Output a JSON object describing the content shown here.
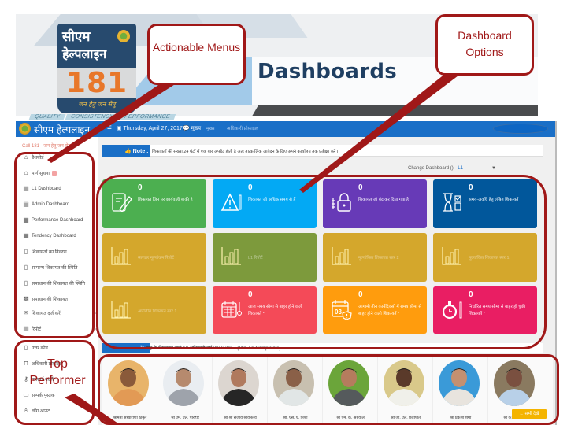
{
  "slide": {
    "title": "Dashboards",
    "tagline_steps": [
      "QUALITY",
      "CONSISTENCY",
      "PERFORMANCE"
    ]
  },
  "logo": {
    "line1": "सीएम",
    "line2": "हेल्पलाइन",
    "number": "181",
    "tagline": "जन हेतु जन सेतु"
  },
  "annotations": {
    "actionable_menus": "Actionable Menus",
    "dashboard_options": "Dashboard Options",
    "top_performer": "Top Performer",
    "color": "#a01818"
  },
  "appbar": {
    "brand": "सीएम हेल्पलाइन",
    "menu_icon": "≡",
    "date": "Thursday, April 27, 2017",
    "messages_label": "मुख्य",
    "link1": "मुख्य",
    "link2": "अधिकारी प्रोफ़ाइल",
    "color": "#1a6fc7"
  },
  "sidebar": {
    "phone": "Call 181 - जन हेतु जन सेतु",
    "items": [
      {
        "label": "डैशबोर्ड",
        "icon": "home-icon"
      },
      {
        "label": "मार्ग सूचना",
        "icon": "home-icon",
        "badge": true
      },
      {
        "label": "L1 Dashboard",
        "icon": "clipboard-icon"
      },
      {
        "label": "Admin Dashboard",
        "icon": "clipboard-icon"
      },
      {
        "label": "Performance Dashboard",
        "icon": "chart-icon"
      },
      {
        "label": "Tendency Dashboard",
        "icon": "chart-icon"
      },
      {
        "label": "शिकायतों का विवरण",
        "icon": "document-icon"
      },
      {
        "label": "सामान्य शिकायत की स्थिति",
        "icon": "document-icon"
      },
      {
        "label": "समाधान की शिकायत की स्थिति",
        "icon": "document-icon"
      },
      {
        "label": "समाधान की शिकायत",
        "icon": "grid-icon"
      },
      {
        "label": "शिकायत दर्ज करें",
        "icon": "mail-icon",
        "chevron": true
      },
      {
        "label": "रिपोर्ट",
        "icon": "calendar-icon",
        "chevron": true
      },
      {
        "label": "उत्तर कोड",
        "icon": "file-icon"
      },
      {
        "label": "अधिकारी प्रोफ़ाइल",
        "icon": "lock-icon"
      },
      {
        "label": "पासवर्ड बदलें",
        "icon": "key-icon"
      },
      {
        "label": "सम्पर्क पुस्तक",
        "icon": "book-icon"
      },
      {
        "label": "लॉग आउट",
        "icon": "user-icon"
      }
    ]
  },
  "note": {
    "tag": "Note :",
    "text": "शिकायतों की संख्या 24 घंटों में एक बार अपडेट होती है अतः तात्कालिक आवेदन के लिए अपने कार्यालय तक प्रतीक्षा करें |"
  },
  "change_dashboard": {
    "label": "Change Dashboard ()",
    "selected": "L1",
    "caret": "▼"
  },
  "tiles": [
    {
      "count": "0",
      "label": "शिकायत जिन पर कार्यवाही बाकी है",
      "color": "#4caf50",
      "icon": "edit-document-icon"
    },
    {
      "count": "0",
      "label": "शिकायत जो अधिक समय से हैं",
      "color": "#03a9f4",
      "icon": "warning-icon"
    },
    {
      "count": "0",
      "label": "शिकायत जो बंद कर दिया गया है",
      "color": "#673ab7",
      "icon": "lock-icon"
    },
    {
      "count": "0",
      "label": "समय-अवधि हेतु लंबित शिकायतें",
      "color": "#01579b",
      "icon": "hourglass-icon"
    },
    {
      "count": "",
      "label": "स्तरवार मूल्यांकन रिपोर्ट",
      "color": "#d4a72c",
      "icon": "bar-chart-icon"
    },
    {
      "count": "",
      "label": "L1 रिपोर्ट",
      "color": "#7d9a3c",
      "icon": "bar-chart-icon"
    },
    {
      "count": "",
      "label": "मूल्यांकित शिकायत स्तर 2",
      "color": "#d4a72c",
      "icon": "bar-chart-icon"
    },
    {
      "count": "",
      "label": "मूल्यांकित शिकायत स्तर 1",
      "color": "#d4a72c",
      "icon": "bar-chart-icon"
    },
    {
      "count": "",
      "label": "अपीलीय शिकायत स्तर 1",
      "color": "#d4a72c",
      "icon": "bar-chart-icon"
    },
    {
      "count": "0",
      "label": "आज समय सीमा से बाहर होने वाली शिकायतें *",
      "color": "#f44a58",
      "icon": "calendar-timer-icon"
    },
    {
      "count": "0",
      "label": "आगामी तीन कार्यदिवसों में समय सीमा से बाहर होने वाली शिकायतें *",
      "color": "#ff9c0d",
      "icon": "calendar-alert-icon"
    },
    {
      "count": "0",
      "label": "निर्धारित समय सीमा से बाहर हो चुकी शिकायतें *",
      "color": "#e91e63",
      "icon": "stopwatch-icon"
    }
  ],
  "performers_bar": {
    "text": "माह के शिकायत वाले 10 अधिकारी वर्ष 2016-2017 (Min. 50 Complaints)"
  },
  "performers": [
    {
      "name": "श्रीमती संध्याराणा ठाकुर",
      "bg": "#e8b46a",
      "skin": "#8a5a3a",
      "cloth": "#e29a55"
    },
    {
      "name": "श्री एम. एल. परिहार",
      "bg": "#e9edf1",
      "skin": "#b68a6e",
      "cloth": "#9ea3ab"
    },
    {
      "name": "श्री श्री संजीव श्रीवास्तव",
      "bg": "#dcd6d0",
      "skin": "#b07a5e",
      "cloth": "#262626"
    },
    {
      "name": "श्री. एस. ए. मिश्रा",
      "bg": "#c8c0b0",
      "skin": "#8a6048",
      "cloth": "#e1e6e6"
    },
    {
      "name": "श्री एम. के. अग्रवाल",
      "bg": "#6ba53a",
      "skin": "#b67c5e",
      "cloth": "#555a5c"
    },
    {
      "name": "श्री जी. एल. प्रजापति",
      "bg": "#d9c98a",
      "skin": "#5a3a2a",
      "cloth": "#f0f0ea"
    },
    {
      "name": "श्री प्रकाश शर्मा",
      "bg": "#3a9ad8",
      "skin": "#c49070",
      "cloth": "#e8e4de"
    },
    {
      "name": "श्री के. एस. यादव",
      "bg": "#8a7a60",
      "skin": "#7a5040",
      "cloth": "#b8d0e8"
    }
  ],
  "more_button": "← सभी देखें"
}
